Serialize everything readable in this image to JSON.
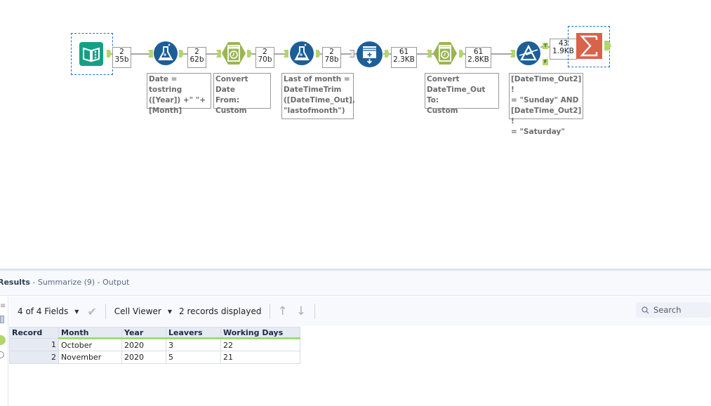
{
  "canvas": {
    "tools": [
      {
        "name": "input-data-tool",
        "icon": "book-icon",
        "color": "#15a086"
      },
      {
        "name": "formula-tool-1",
        "icon": "flask-icon",
        "color": "#1d5e96",
        "annotation": "Date = tostring\n([Year]) +\" \"+\n[Month]"
      },
      {
        "name": "datetime-tool-1",
        "icon": "clock-icon",
        "color": "#9bb554",
        "annotation": "Convert Date\nFrom:\nCustom"
      },
      {
        "name": "formula-tool-2",
        "icon": "flask-icon",
        "color": "#1d5e96",
        "annotation": "Last of month =\nDateTimeTrim\n([DateTime_Out],\n\"lastofmonth\")"
      },
      {
        "name": "generate-rows-tool",
        "icon": "generate-rows-icon",
        "color": "#1d5e96"
      },
      {
        "name": "datetime-tool-2",
        "icon": "clock-icon",
        "color": "#9bb554",
        "annotation": "Convert\nDateTime_Out To:\nCustom"
      },
      {
        "name": "filter-tool",
        "icon": "filter-icon",
        "color": "#1d5e96",
        "annotation": "[DateTime_Out2] !\n= \"Sunday\" AND\n[DateTime_Out2] !\n= \"Saturday\""
      },
      {
        "name": "summarize-tool",
        "icon": "sigma-icon",
        "color": "#d9624a"
      }
    ],
    "counts": [
      {
        "records": "2",
        "size": "35b"
      },
      {
        "records": "2",
        "size": "62b"
      },
      {
        "records": "2",
        "size": "70b"
      },
      {
        "records": "2",
        "size": "78b"
      },
      {
        "records": "61",
        "size": "2.3KB"
      },
      {
        "records": "61",
        "size": "2.8KB"
      },
      {
        "records": "43",
        "size": "1.9KB"
      }
    ],
    "filter_anchors": {
      "true": "T",
      "false": "F"
    }
  },
  "results": {
    "title": "Results",
    "subtitle": " - Summarize (9) - Output",
    "toolbar": {
      "fields": "4 of 4 Fields",
      "cell_viewer": "Cell Viewer",
      "records_displayed": "2 records displayed",
      "search_placeholder": "Search"
    },
    "table": {
      "columns": [
        "Record",
        "Month",
        "Year",
        "Leavers",
        "Working Days"
      ],
      "rows": [
        [
          "1",
          "October",
          "2020",
          "3",
          "22"
        ],
        [
          "2",
          "November",
          "2020",
          "5",
          "21"
        ]
      ]
    }
  }
}
